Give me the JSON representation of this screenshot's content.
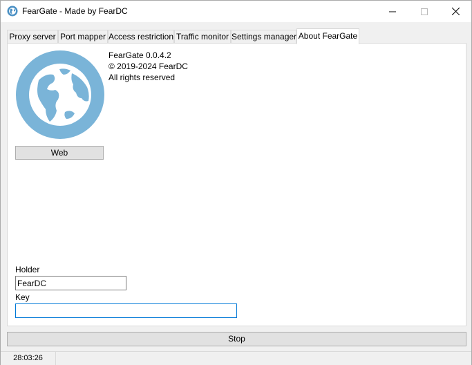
{
  "window": {
    "title": "FearGate - Made by FearDC",
    "app_icon": "globe-icon",
    "controls": [
      "minimize-icon",
      "maximize-icon",
      "close-icon"
    ]
  },
  "tabs": [
    {
      "label": "Proxy server",
      "active": false
    },
    {
      "label": "Port mapper",
      "active": false
    },
    {
      "label": "Access restriction",
      "active": false
    },
    {
      "label": "Traffic monitor",
      "active": false
    },
    {
      "label": "Settings manager",
      "active": false
    },
    {
      "label": "About FearGate",
      "active": true
    }
  ],
  "about": {
    "logo_icon": "globe-icon",
    "logo_color": "#7ab4d8",
    "version": "FearGate 0.0.4.2",
    "copyright": "© 2019-2024 FearDC",
    "rights": "All rights reserved",
    "web_button_label": "Web",
    "holder_label": "Holder",
    "holder_value": "FearDC",
    "key_label": "Key",
    "key_value": ""
  },
  "stop_button_label": "Stop",
  "status": {
    "elapsed": "28:03:26"
  },
  "colors": {
    "focus_border": "#0078d7",
    "button_face": "#e1e1e1",
    "window_bg": "#f0f0f0"
  }
}
